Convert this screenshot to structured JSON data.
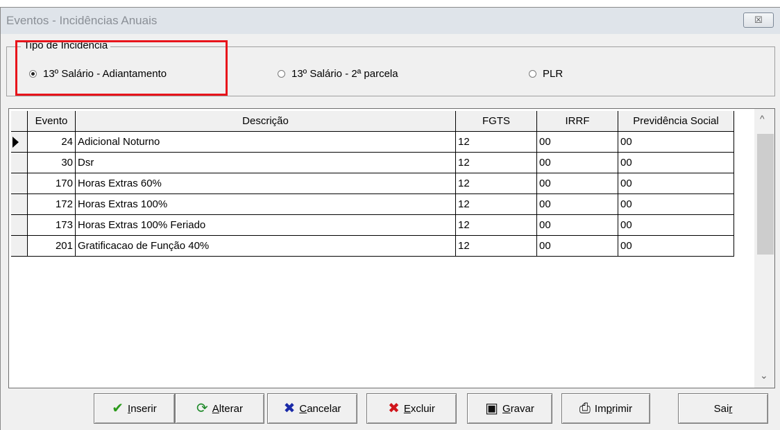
{
  "window": {
    "title": "Eventos - Incidências Anuais",
    "close_glyph": "☒"
  },
  "group": {
    "legend": "Tipo de Incidência",
    "options": [
      {
        "label": "13º Salário - Adiantamento",
        "checked": true
      },
      {
        "label": "13º Salário - 2ª parcela",
        "checked": false
      },
      {
        "label": "PLR",
        "checked": false
      }
    ]
  },
  "table": {
    "columns": [
      "Evento",
      "Descrição",
      "FGTS",
      "IRRF",
      "Previdência Social"
    ],
    "rows": [
      {
        "evento": "24",
        "descricao": "Adicional Noturno",
        "fgts": "12",
        "irrf": "00",
        "prev": "00",
        "current": true
      },
      {
        "evento": "30",
        "descricao": "Dsr",
        "fgts": "12",
        "irrf": "00",
        "prev": "00"
      },
      {
        "evento": "170",
        "descricao": "Horas Extras 60%",
        "fgts": "12",
        "irrf": "00",
        "prev": "00"
      },
      {
        "evento": "172",
        "descricao": "Horas Extras 100%",
        "fgts": "12",
        "irrf": "00",
        "prev": "00"
      },
      {
        "evento": "173",
        "descricao": "Horas Extras 100% Feriado",
        "fgts": "12",
        "irrf": "00",
        "prev": "00"
      },
      {
        "evento": "201",
        "descricao": "Gratificacao de Função 40%",
        "fgts": "12",
        "irrf": "00",
        "prev": "00"
      }
    ]
  },
  "buttons": [
    {
      "name": "inserir-button",
      "label_pre": "",
      "label_u": "I",
      "label_post": "nserir",
      "icon": "check-icon",
      "glyph": "✔",
      "color": "#2b9a1a"
    },
    {
      "name": "alterar-button",
      "label_pre": "",
      "label_u": "A",
      "label_post": "lterar",
      "icon": "refresh-icon",
      "glyph": "⟳",
      "color": "#1f8a2a"
    },
    {
      "name": "cancelar-button",
      "label_pre": "",
      "label_u": "C",
      "label_post": "ancelar",
      "icon": "cancel-icon",
      "glyph": "✖",
      "color": "#1a2aa8"
    },
    {
      "name": "excluir-button",
      "label_pre": "",
      "label_u": "E",
      "label_post": "xcluir",
      "icon": "delete-icon",
      "glyph": "✖",
      "color": "#d0141a"
    },
    {
      "name": "gravar-button",
      "label_pre": "",
      "label_u": "G",
      "label_post": "ravar",
      "icon": "save-icon",
      "glyph": "▣",
      "color": "#111111"
    },
    {
      "name": "imprimir-button",
      "label_pre": "Im",
      "label_u": "p",
      "label_post": "rimir",
      "icon": "printer-icon",
      "glyph": "⎙",
      "color": "#111111"
    },
    {
      "name": "sair-button",
      "label_pre": "Sai",
      "label_u": "r",
      "label_post": "",
      "icon": "",
      "glyph": "",
      "color": "#000000"
    }
  ],
  "scroll": {
    "up": "^",
    "down": "⌄"
  }
}
